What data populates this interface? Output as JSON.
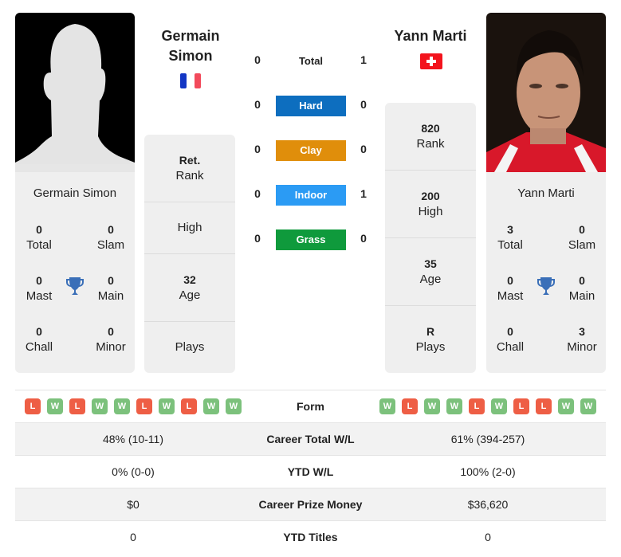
{
  "player1": {
    "name": "Germain Simon",
    "name_line1": "Germain",
    "name_line2": "Simon",
    "country_flag": "france-flag",
    "photo": "silhouette-placeholder",
    "titles": {
      "total": {
        "value": "0",
        "label": "Total"
      },
      "slam": {
        "value": "0",
        "label": "Slam"
      },
      "mast": {
        "value": "0",
        "label": "Mast"
      },
      "main": {
        "value": "0",
        "label": "Main"
      },
      "chall": {
        "value": "0",
        "label": "Chall"
      },
      "minor": {
        "value": "0",
        "label": "Minor"
      }
    },
    "info": {
      "rank": {
        "value": "Ret.",
        "label": "Rank"
      },
      "high": {
        "value": "",
        "label": "High"
      },
      "age": {
        "value": "32",
        "label": "Age"
      },
      "plays": {
        "value": "",
        "label": "Plays"
      }
    },
    "form": [
      "L",
      "W",
      "L",
      "W",
      "W",
      "L",
      "W",
      "L",
      "W",
      "W"
    ],
    "career_total_wl": "48% (10-11)",
    "ytd_wl": "0% (0-0)",
    "career_prize_money": "$0",
    "ytd_titles": "0"
  },
  "player2": {
    "name": "Yann Marti",
    "country_flag": "switzerland-flag",
    "photo": "player-photo",
    "titles": {
      "total": {
        "value": "3",
        "label": "Total"
      },
      "slam": {
        "value": "0",
        "label": "Slam"
      },
      "mast": {
        "value": "0",
        "label": "Mast"
      },
      "main": {
        "value": "0",
        "label": "Main"
      },
      "chall": {
        "value": "0",
        "label": "Chall"
      },
      "minor": {
        "value": "3",
        "label": "Minor"
      }
    },
    "info": {
      "rank": {
        "value": "820",
        "label": "Rank"
      },
      "high": {
        "value": "200",
        "label": "High"
      },
      "age": {
        "value": "35",
        "label": "Age"
      },
      "plays": {
        "value": "R",
        "label": "Plays"
      }
    },
    "form": [
      "W",
      "L",
      "W",
      "W",
      "L",
      "W",
      "L",
      "L",
      "W",
      "W"
    ],
    "career_total_wl": "61% (394-257)",
    "ytd_wl": "100% (2-0)",
    "career_prize_money": "$36,620",
    "ytd_titles": "0"
  },
  "h2h": {
    "total": {
      "label": "Total",
      "p1": "0",
      "p2": "1"
    },
    "surfaces": [
      {
        "label": "Hard",
        "p1": "0",
        "p2": "0",
        "color": "#0d6ebf"
      },
      {
        "label": "Clay",
        "p1": "0",
        "p2": "0",
        "color": "#e08e0b"
      },
      {
        "label": "Indoor",
        "p1": "0",
        "p2": "1",
        "color": "#2b9bf4"
      },
      {
        "label": "Grass",
        "p1": "0",
        "p2": "0",
        "color": "#0f9a3c"
      }
    ]
  },
  "comparison": {
    "form_label": "Form",
    "career_total_wl_label": "Career Total W/L",
    "ytd_wl_label": "YTD W/L",
    "career_prize_money_label": "Career Prize Money",
    "ytd_titles_label": "YTD Titles"
  },
  "colors": {
    "win": "#7cc17c",
    "loss": "#ee5e45",
    "trophy": "#3a6fb8",
    "card_bg": "#efefef"
  }
}
